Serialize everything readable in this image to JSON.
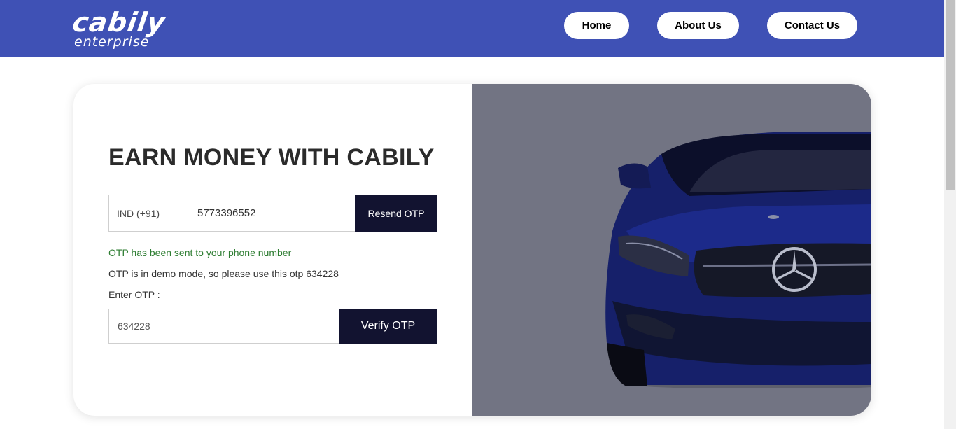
{
  "header": {
    "logo_brand": "cabily",
    "logo_sub": "enterprise",
    "nav": {
      "home": "Home",
      "about": "About Us",
      "contact": "Contact Us"
    }
  },
  "main": {
    "heading": "EARN MONEY WITH CABILY",
    "country_code": "IND (+91)",
    "phone_number": "5773396552",
    "resend_label": "Resend OTP",
    "sent_message": "OTP has been sent to your phone number",
    "demo_message": "OTP is in demo mode, so please use this otp 634228",
    "otp_label": "Enter OTP :",
    "otp_value": "634228",
    "verify_label": "Verify OTP"
  },
  "colors": {
    "header_bg": "#3f51b5",
    "button_dark": "#121330",
    "success_text": "#2e7d32",
    "image_panel_bg": "#727483"
  }
}
